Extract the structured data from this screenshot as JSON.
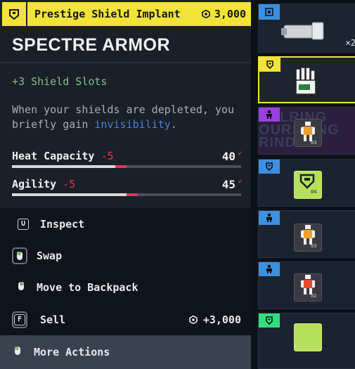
{
  "header": {
    "item_type": "Prestige Shield Implant",
    "price": "3,000",
    "header_color": "#f2e437"
  },
  "item": {
    "name": "SPECTRE ARMOR",
    "stat_line": "+3 Shield Slots",
    "description_pre": "When your shields are depleted, you briefly gain ",
    "description_highlight": "invisibility",
    "description_post": ".",
    "attributes": [
      {
        "label": "Heat Capacity",
        "delta": "-5",
        "value": "40",
        "fill_fraction": 0.45,
        "loss_fraction": 0.05
      },
      {
        "label": "Agility",
        "delta": "-5",
        "value": "45",
        "fill_fraction": 0.5,
        "loss_fraction": 0.05
      }
    ]
  },
  "actions": [
    {
      "label": "Inspect",
      "key": "U",
      "icon": "key-u-icon"
    },
    {
      "label": "Swap",
      "icon": "mouse-icon"
    },
    {
      "label": "Move to Backpack",
      "icon": "mouse-icon"
    },
    {
      "label": "Sell",
      "key": "F",
      "icon": "key-f-icon",
      "price": "+3,000"
    },
    {
      "label": "More Actions",
      "icon": "mouse-icon"
    }
  ],
  "inventory": {
    "slots": [
      {
        "multiplier": "×2"
      },
      {},
      {
        "sublabel": "03"
      },
      {
        "sublabel": "04"
      },
      {
        "sublabel": "03"
      },
      {
        "sublabel": "02"
      },
      {}
    ]
  },
  "colors": {
    "accent_yellow": "#f2e437",
    "negative": "#e8325b",
    "positive": "#7dc587",
    "highlight_blue": "#4a7fe0",
    "tag_blue": "#3d8fe0",
    "tag_purple": "#9b3fe0",
    "tag_green": "#2fe07a"
  }
}
